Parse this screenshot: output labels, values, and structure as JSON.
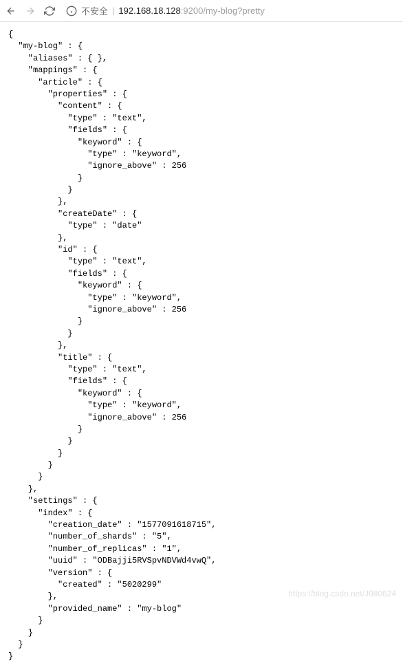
{
  "toolbar": {
    "security_label": "不安全",
    "url_host": "192.168.18.128",
    "url_port": ":9200",
    "url_path": "/my-blog?pretty"
  },
  "watermark": "https://blog.csdn.net/J080624",
  "json_response": {
    "my-blog": {
      "aliases": {},
      "mappings": {
        "article": {
          "properties": {
            "content": {
              "type": "text",
              "fields": {
                "keyword": {
                  "type": "keyword",
                  "ignore_above": 256
                }
              }
            },
            "createDate": {
              "type": "date"
            },
            "id": {
              "type": "text",
              "fields": {
                "keyword": {
                  "type": "keyword",
                  "ignore_above": 256
                }
              }
            },
            "title": {
              "type": "text",
              "fields": {
                "keyword": {
                  "type": "keyword",
                  "ignore_above": 256
                }
              }
            }
          }
        }
      },
      "settings": {
        "index": {
          "creation_date": "1577091618715",
          "number_of_shards": "5",
          "number_of_replicas": "1",
          "uuid": "ODBajji5RVSpvNDVWd4vwQ",
          "version": {
            "created": "5020299"
          },
          "provided_name": "my-blog"
        }
      }
    }
  },
  "json_text": "{\n  \"my-blog\" : {\n    \"aliases\" : { },\n    \"mappings\" : {\n      \"article\" : {\n        \"properties\" : {\n          \"content\" : {\n            \"type\" : \"text\",\n            \"fields\" : {\n              \"keyword\" : {\n                \"type\" : \"keyword\",\n                \"ignore_above\" : 256\n              }\n            }\n          },\n          \"createDate\" : {\n            \"type\" : \"date\"\n          },\n          \"id\" : {\n            \"type\" : \"text\",\n            \"fields\" : {\n              \"keyword\" : {\n                \"type\" : \"keyword\",\n                \"ignore_above\" : 256\n              }\n            }\n          },\n          \"title\" : {\n            \"type\" : \"text\",\n            \"fields\" : {\n              \"keyword\" : {\n                \"type\" : \"keyword\",\n                \"ignore_above\" : 256\n              }\n            }\n          }\n        }\n      }\n    },\n    \"settings\" : {\n      \"index\" : {\n        \"creation_date\" : \"1577091618715\",\n        \"number_of_shards\" : \"5\",\n        \"number_of_replicas\" : \"1\",\n        \"uuid\" : \"ODBajji5RVSpvNDVWd4vwQ\",\n        \"version\" : {\n          \"created\" : \"5020299\"\n        },\n        \"provided_name\" : \"my-blog\"\n      }\n    }\n  }\n}"
}
